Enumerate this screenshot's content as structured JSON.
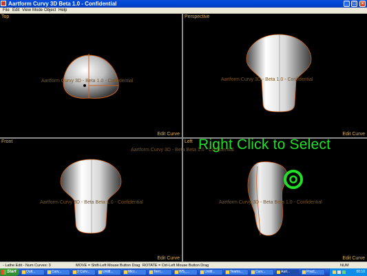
{
  "window": {
    "title": "Aartform Curvy 3D Beta 1.0 - Confidential",
    "controls": {
      "minimize": "_",
      "maximize": "□",
      "close": "×"
    }
  },
  "menu": [
    "File",
    "Edit",
    "View",
    "Mode",
    "Object",
    "Help"
  ],
  "viewports": {
    "top": {
      "label": "Top",
      "edit": "Edit Curve"
    },
    "perspective": {
      "label": "Perspective",
      "edit": "Edit Curve"
    },
    "front": {
      "label": "Front",
      "edit": "Edit Curve"
    },
    "left": {
      "label": "Left",
      "edit": "Edit Curve"
    }
  },
  "watermarks": {
    "top": "Aartform Curvy 3D - Beta 1.0 - Confidential",
    "perspective": "Aartform Curvy 3D - Beta 1.0 - Confidential",
    "middle": "Aartform Curvy 3D - Beta Beta 1.0 - Confidential",
    "front": "Aartform Curvy 3D - Beta Beta 1.0 - Confidential",
    "left": "Aartform Curvy 3D - Beta Beta 1.0 - Confidential"
  },
  "overlay_message": "Right Click to Select",
  "status": {
    "mode": "- Lathe Edit - Num Curves: 3",
    "move": "MOVE = Shift-Left Mouse Button Drag",
    "rotate": "ROTATE = Ctrl-Left Mouse Button Drag",
    "num": "NUM"
  },
  "taskbar": {
    "start": "Start",
    "apps": [
      "Outl...",
      "Curv...",
      "2 Curv...",
      "Untitl...",
      "Micr...",
      "Terri...",
      "WS_...",
      "Untitl...",
      "Teams...",
      "Curv...",
      "Aart...",
      "Pract..."
    ],
    "active_index": 10,
    "clock": "00:10"
  },
  "colors": {
    "accent_text": "#e0b050",
    "curve": "#d0621e",
    "overlay": "#22e02a",
    "titlebar": "#0046d5"
  }
}
